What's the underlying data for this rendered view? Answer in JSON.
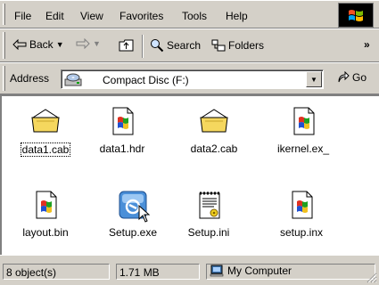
{
  "menubar": {
    "items": [
      "File",
      "Edit",
      "View",
      "Favorites",
      "Tools",
      "Help"
    ]
  },
  "toolbar": {
    "back_label": "Back",
    "search_label": "Search",
    "folders_label": "Folders",
    "overflow_label": "»"
  },
  "addressbar": {
    "label": "Address",
    "value": "Compact Disc (F:)",
    "go_label": "Go"
  },
  "files": [
    {
      "name": "data1.cab",
      "icon": "folder-cab-icon",
      "focused": true
    },
    {
      "name": "data1.hdr",
      "icon": "document-icon",
      "focused": false
    },
    {
      "name": "data2.cab",
      "icon": "folder-cab-icon",
      "focused": false
    },
    {
      "name": "ikernel.ex_",
      "icon": "document-icon",
      "focused": false
    },
    {
      "name": "layout.bin",
      "icon": "document-icon",
      "focused": false
    },
    {
      "name": "Setup.exe",
      "icon": "setup-icon",
      "focused": false
    },
    {
      "name": "Setup.ini",
      "icon": "ini-icon",
      "focused": false
    },
    {
      "name": "setup.inx",
      "icon": "document-icon",
      "focused": false
    }
  ],
  "statusbar": {
    "objects": "8 object(s)",
    "size": "1.71 MB",
    "location": "My Computer"
  }
}
